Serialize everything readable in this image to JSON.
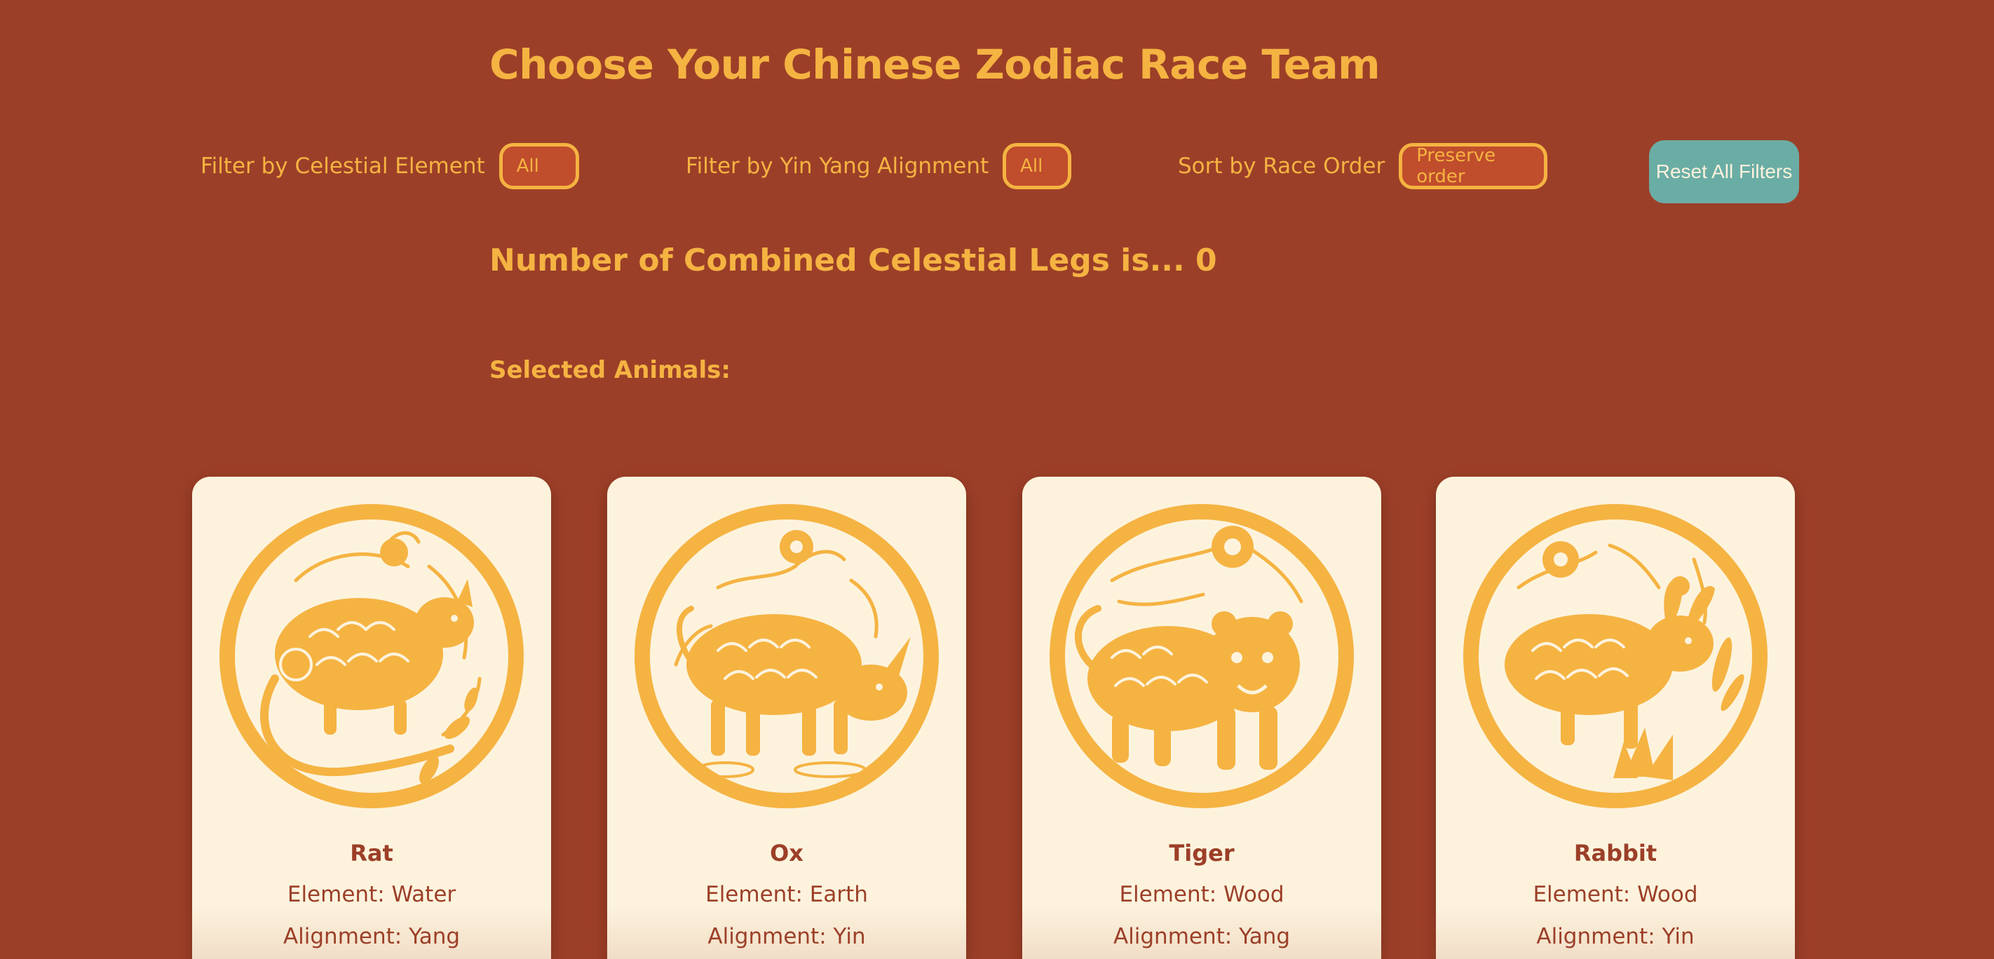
{
  "header": {
    "title": "Choose Your Chinese Zodiac Race Team"
  },
  "filters": {
    "element_label": "Filter by Celestial Element",
    "element_value": "All",
    "alignment_label": "Filter by Yin Yang Alignment",
    "alignment_value": "All",
    "sort_label": "Sort by Race Order",
    "sort_value": "Preserve order",
    "reset_label": "Reset All Filters"
  },
  "summary": {
    "legs_text": "Number of Combined Celestial Legs is... 0",
    "selected_heading": "Selected Animals:"
  },
  "colors": {
    "background": "#9c3f28",
    "gold": "#f5b342",
    "card": "#fdf3dd",
    "reset_button": "#6aada5"
  },
  "animals": [
    {
      "name": "Rat",
      "element": "Element: Water",
      "alignment": "Alignment: Yang",
      "icon": "rat-papercut-icon"
    },
    {
      "name": "Ox",
      "element": "Element: Earth",
      "alignment": "Alignment: Yin",
      "icon": "ox-papercut-icon"
    },
    {
      "name": "Tiger",
      "element": "Element: Wood",
      "alignment": "Alignment: Yang",
      "icon": "tiger-papercut-icon"
    },
    {
      "name": "Rabbit",
      "element": "Element: Wood",
      "alignment": "Alignment: Yin",
      "icon": "rabbit-papercut-icon"
    }
  ]
}
